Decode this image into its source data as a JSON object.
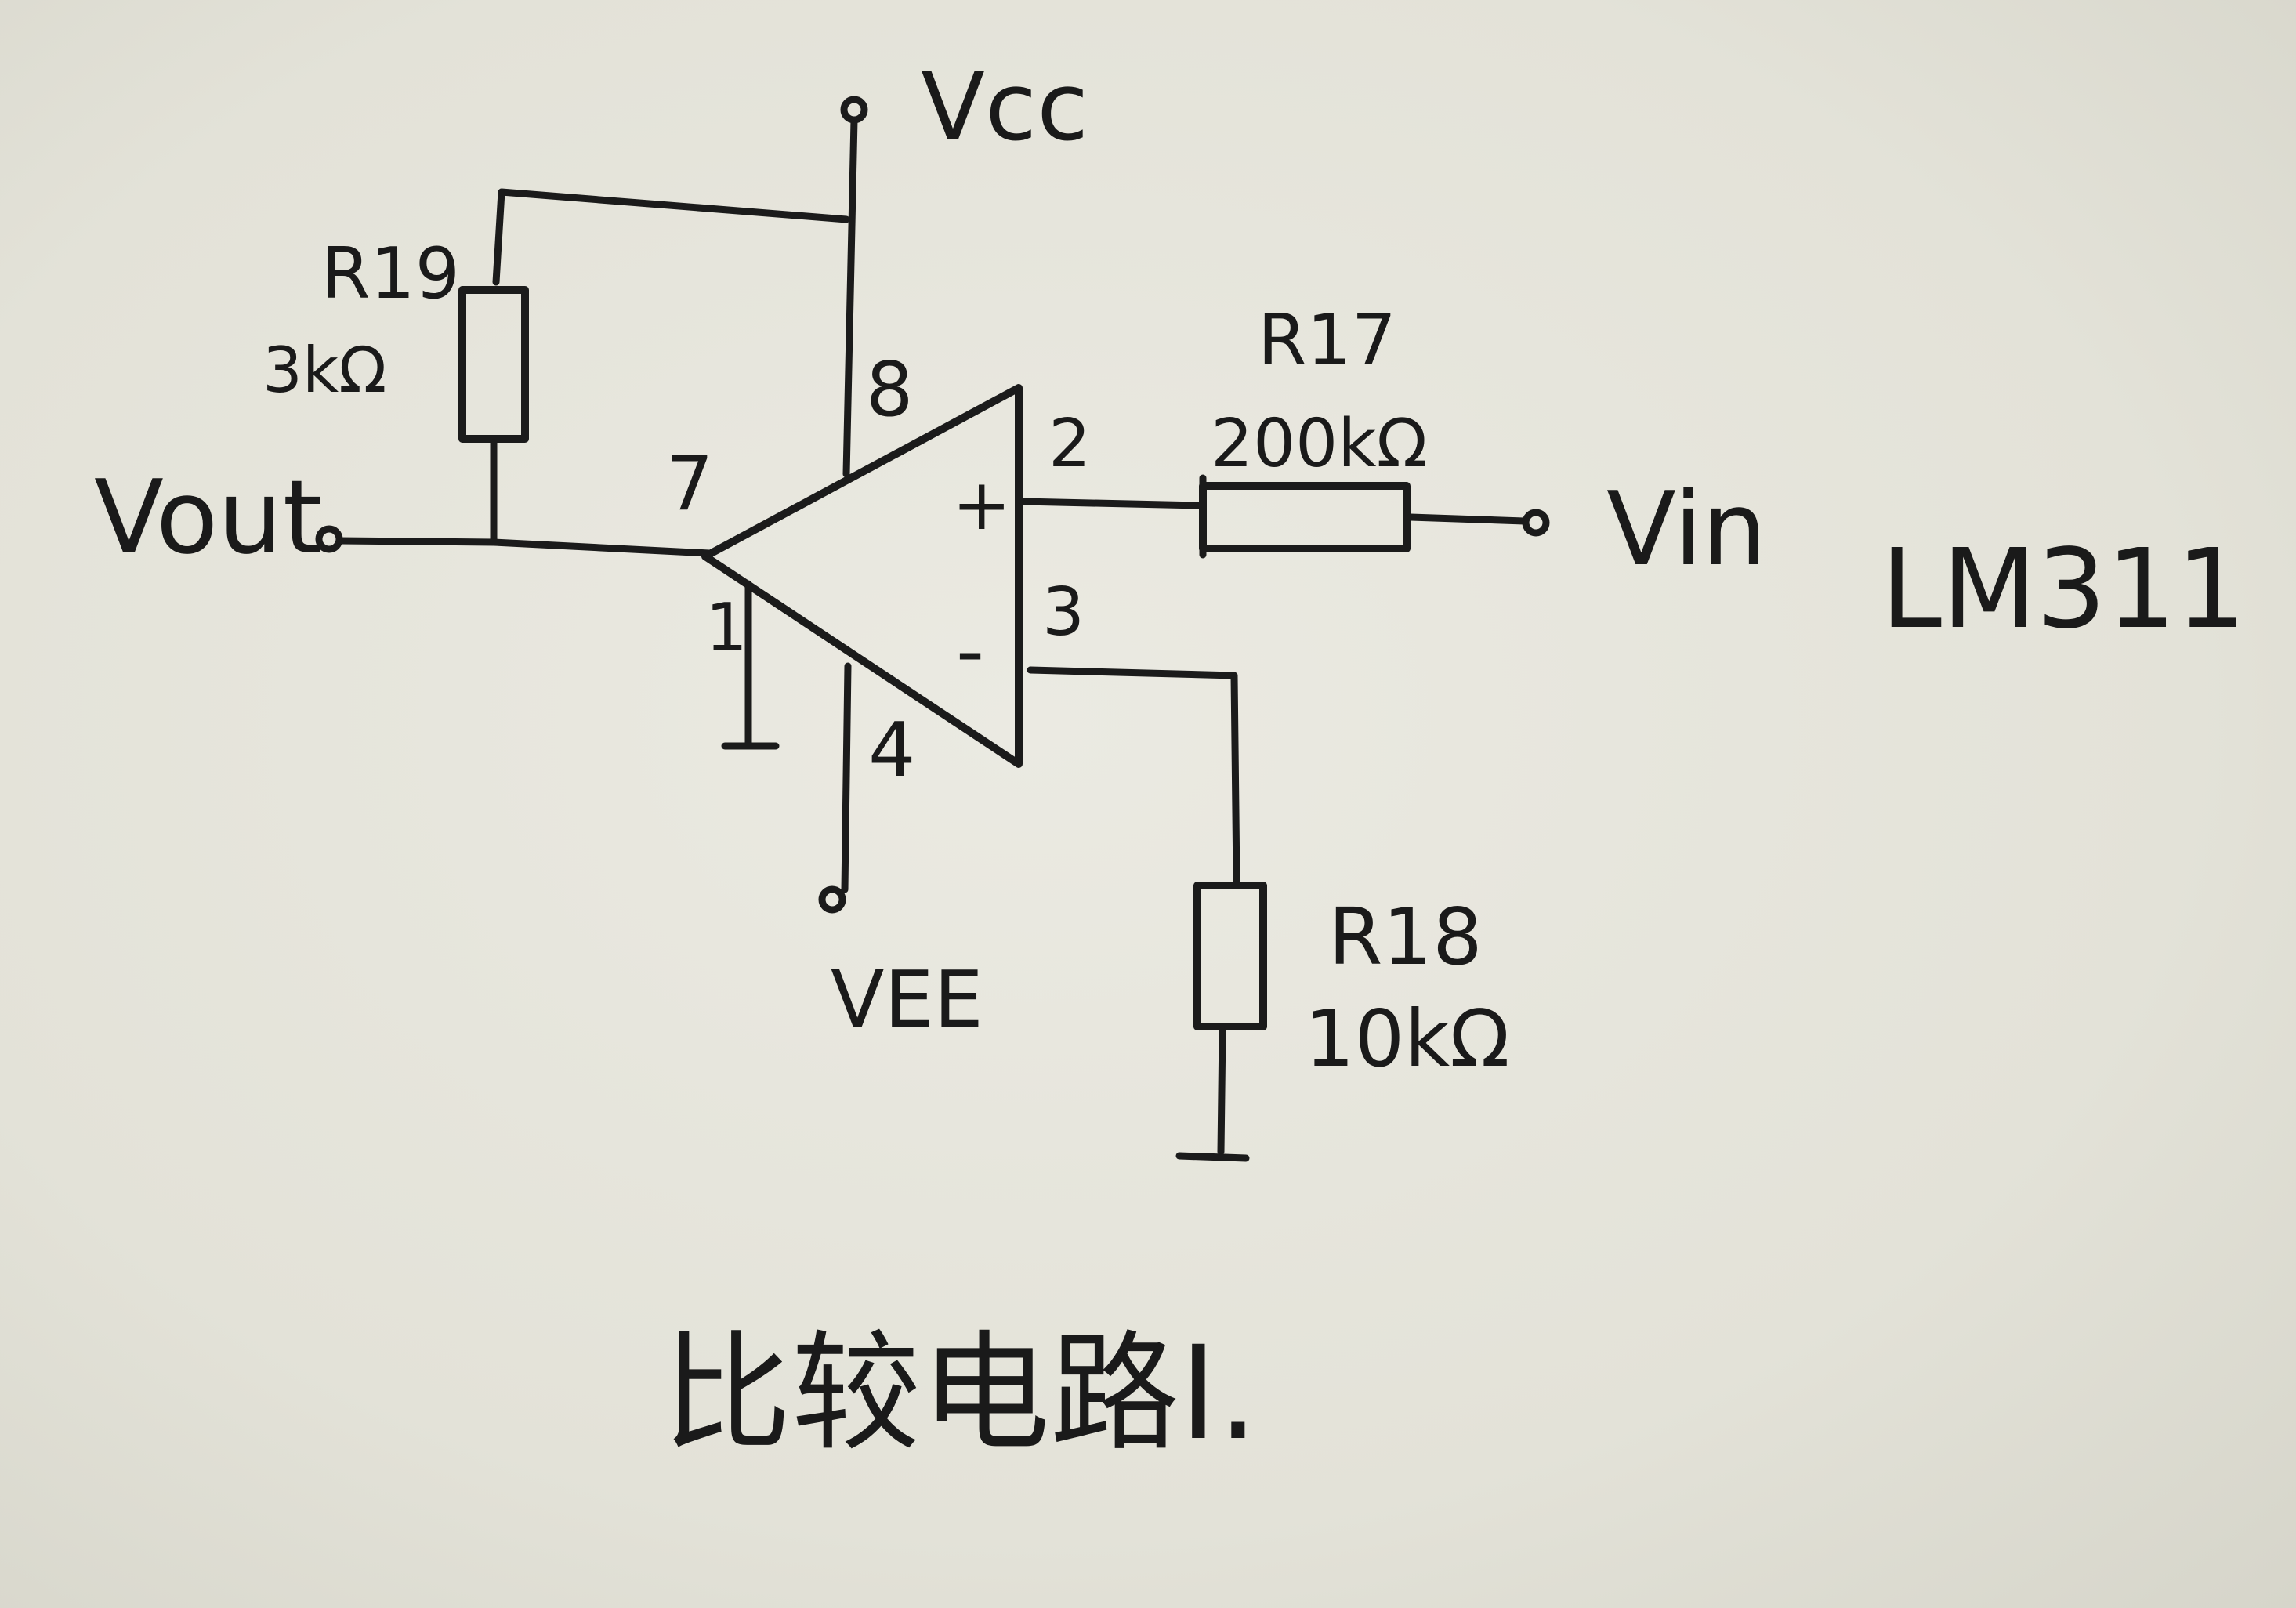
{
  "title": "比较电路I.",
  "chip": "LM311",
  "terminals": {
    "vcc": "Vcc",
    "vee": "VEE",
    "vout": "Vout",
    "vin": "Vin"
  },
  "pins": {
    "p1": "1",
    "p2": "2",
    "p3": "3",
    "p4": "4",
    "p7": "7",
    "p8": "8"
  },
  "signs": {
    "plus": "+",
    "minus": "-"
  },
  "resistors": {
    "r17": {
      "name": "R17",
      "value": "200kΩ"
    },
    "r18": {
      "name": "R18",
      "value": "10kΩ"
    },
    "r19": {
      "name": "R19",
      "value": "3kΩ"
    }
  }
}
